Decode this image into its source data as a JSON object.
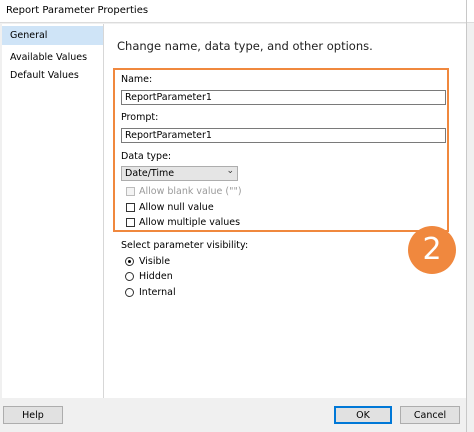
{
  "window": {
    "title": "Report Parameter Properties"
  },
  "sidebar": {
    "items": [
      {
        "label": "General",
        "selected": true
      },
      {
        "label": "Available Values",
        "selected": false
      },
      {
        "label": "Default Values",
        "selected": false
      }
    ]
  },
  "main": {
    "heading": "Change name, data type, and other options.",
    "name_label": "Name:",
    "name_value": "ReportParameter1",
    "prompt_label": "Prompt:",
    "prompt_value": "ReportParameter1",
    "data_type_label": "Data type:",
    "data_type_value": "Date/Time",
    "allow_blank_label": "Allow blank value (\"\")",
    "allow_null_label": "Allow null value",
    "allow_multiple_label": "Allow multiple values",
    "visibility_label": "Select parameter visibility:",
    "visibility_options": [
      "Visible",
      "Hidden",
      "Internal"
    ],
    "visibility_selected": "Visible"
  },
  "annotation": {
    "number": "2",
    "color": "#f0883e"
  },
  "footer": {
    "help_label": "Help",
    "ok_label": "OK",
    "cancel_label": "Cancel"
  },
  "colors": {
    "selection": "#cfe4f7",
    "accent": "#0078d7",
    "highlight": "#f0883e"
  }
}
